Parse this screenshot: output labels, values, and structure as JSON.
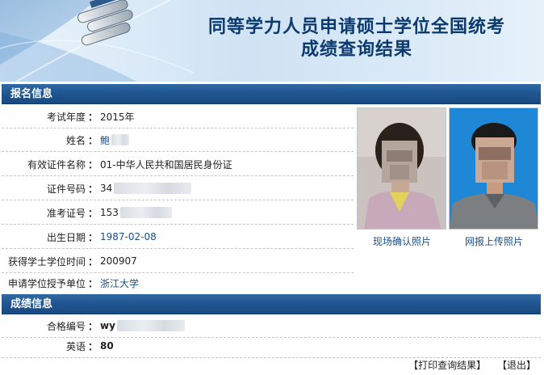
{
  "header": {
    "title_line1": "同等学力人员申请硕士学位全国统考",
    "title_line2": "成绩查询结果"
  },
  "registration": {
    "section_title": "报名信息",
    "rows": [
      {
        "label": "考试年度",
        "value": "2015年"
      },
      {
        "label": "姓名",
        "value": "鲍"
      },
      {
        "label": "有效证件名称",
        "value": "01-中华人民共和国居民身份证"
      },
      {
        "label": "证件号码",
        "value": "34"
      },
      {
        "label": "准考证号",
        "value": "153"
      },
      {
        "label": "出生日期",
        "value": "1987-02-08"
      },
      {
        "label": "获得学士学位时间",
        "value": "200907"
      },
      {
        "label": "申请学位授予单位",
        "value": "浙江大学"
      }
    ],
    "separator": "：",
    "photo_onsite_caption": "现场确认照片",
    "photo_online_caption": "网报上传照片"
  },
  "scores": {
    "section_title": "成绩信息",
    "rows": [
      {
        "label": "合格编号",
        "value": "wy"
      },
      {
        "label": "英语",
        "value": "80"
      }
    ]
  },
  "actions": {
    "print_label": "【打印查询结果】",
    "exit_label": "【退出】"
  },
  "colors": {
    "section_bar": "#1f5590",
    "title_text": "#0b3a6f",
    "link_text": "#1a4e8a"
  }
}
